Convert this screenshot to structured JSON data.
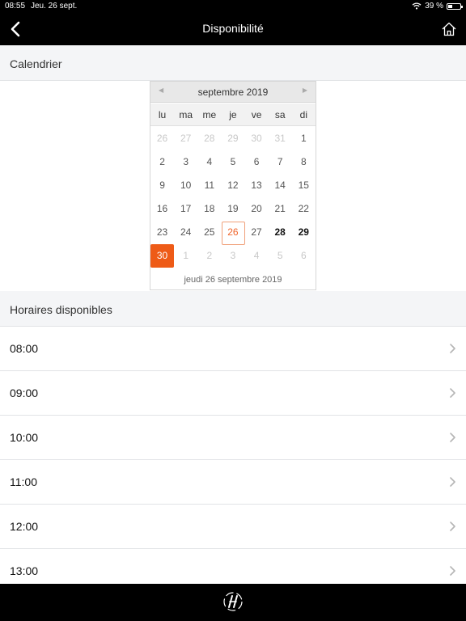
{
  "status": {
    "time": "08:55",
    "date": "Jeu. 26 sept.",
    "battery": "39 %",
    "battery_level": 0.39
  },
  "nav": {
    "title": "Disponibilité"
  },
  "calendar_section": {
    "title": "Calendrier"
  },
  "calendar": {
    "month_label": "septembre 2019",
    "weekdays": [
      "lu",
      "ma",
      "me",
      "je",
      "ve",
      "sa",
      "di"
    ],
    "weeks": [
      [
        {
          "d": "26",
          "s": "out"
        },
        {
          "d": "27",
          "s": "out"
        },
        {
          "d": "28",
          "s": "out"
        },
        {
          "d": "29",
          "s": "out"
        },
        {
          "d": "30",
          "s": "out"
        },
        {
          "d": "31",
          "s": "out"
        },
        {
          "d": "1",
          "s": ""
        }
      ],
      [
        {
          "d": "2",
          "s": ""
        },
        {
          "d": "3",
          "s": ""
        },
        {
          "d": "4",
          "s": ""
        },
        {
          "d": "5",
          "s": ""
        },
        {
          "d": "6",
          "s": ""
        },
        {
          "d": "7",
          "s": ""
        },
        {
          "d": "8",
          "s": ""
        }
      ],
      [
        {
          "d": "9",
          "s": ""
        },
        {
          "d": "10",
          "s": ""
        },
        {
          "d": "11",
          "s": ""
        },
        {
          "d": "12",
          "s": ""
        },
        {
          "d": "13",
          "s": ""
        },
        {
          "d": "14",
          "s": ""
        },
        {
          "d": "15",
          "s": ""
        }
      ],
      [
        {
          "d": "16",
          "s": ""
        },
        {
          "d": "17",
          "s": ""
        },
        {
          "d": "18",
          "s": ""
        },
        {
          "d": "19",
          "s": ""
        },
        {
          "d": "20",
          "s": ""
        },
        {
          "d": "21",
          "s": ""
        },
        {
          "d": "22",
          "s": ""
        }
      ],
      [
        {
          "d": "23",
          "s": ""
        },
        {
          "d": "24",
          "s": ""
        },
        {
          "d": "25",
          "s": ""
        },
        {
          "d": "26",
          "s": "today"
        },
        {
          "d": "27",
          "s": ""
        },
        {
          "d": "28",
          "s": "bold"
        },
        {
          "d": "29",
          "s": "bold"
        }
      ],
      [
        {
          "d": "30",
          "s": "selected"
        },
        {
          "d": "1",
          "s": "out"
        },
        {
          "d": "2",
          "s": "out"
        },
        {
          "d": "3",
          "s": "out"
        },
        {
          "d": "4",
          "s": "out"
        },
        {
          "d": "5",
          "s": "out"
        },
        {
          "d": "6",
          "s": "out"
        }
      ]
    ],
    "footer": "jeudi 26 septembre 2019"
  },
  "slots_section": {
    "title": "Horaires disponibles"
  },
  "slots": [
    "08:00",
    "09:00",
    "10:00",
    "11:00",
    "12:00",
    "13:00"
  ],
  "colors": {
    "accent": "#ee5b17",
    "bar": "#000000",
    "section_bg": "#f4f5f7"
  },
  "icons": {
    "back": "chevron-left-icon",
    "home": "home-icon",
    "slot": "chevron-right-icon",
    "logo": "brand-logo-icon"
  }
}
